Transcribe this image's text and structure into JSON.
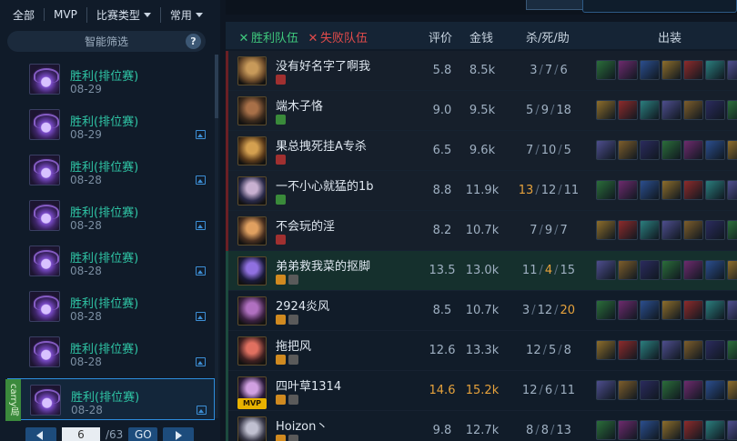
{
  "filter_tabs": [
    {
      "label": "全部"
    },
    {
      "label": "MVP"
    },
    {
      "label": "比赛类型"
    },
    {
      "label": "常用"
    }
  ],
  "smart_filter": {
    "label": "智能筛选",
    "help": "?"
  },
  "matches": [
    {
      "result": "胜利(排位赛)",
      "date": "08-29"
    },
    {
      "result": "胜利(排位赛)",
      "date": "08-29"
    },
    {
      "result": "胜利(排位赛)",
      "date": "08-28"
    },
    {
      "result": "胜利(排位赛)",
      "date": "08-28"
    },
    {
      "result": "胜利(排位赛)",
      "date": "08-28"
    },
    {
      "result": "胜利(排位赛)",
      "date": "08-28"
    },
    {
      "result": "胜利(排位赛)",
      "date": "08-28"
    },
    {
      "result": "胜利(排位赛)",
      "date": "08-28",
      "carry_tag": "carry局"
    }
  ],
  "pager": {
    "page": "6",
    "total": "/63",
    "go": "GO"
  },
  "board": {
    "win_team": "胜利队伍",
    "lose_team": "失败队伍",
    "columns": {
      "rating": "评价",
      "gold": "金钱",
      "kda": "杀/死/助",
      "items": "出装"
    }
  },
  "players": [
    {
      "name": "没有好名字了啊我",
      "rating": "5.8",
      "gold": "8.5k",
      "k": "3",
      "d": "7",
      "a": "6",
      "team": "lose"
    },
    {
      "name": "端木子恪",
      "rating": "9.0",
      "gold": "9.5k",
      "k": "5",
      "d": "9",
      "a": "18",
      "team": "lose"
    },
    {
      "name": "果总拽死挂A专杀",
      "rating": "6.5",
      "gold": "9.6k",
      "k": "7",
      "d": "10",
      "a": "5",
      "team": "lose"
    },
    {
      "name": "一不小心就猛的1b",
      "rating": "8.8",
      "gold": "11.9k",
      "k": "13",
      "d": "12",
      "a": "11",
      "team": "lose",
      "hi_k": true
    },
    {
      "name": "不会玩的淫",
      "rating": "8.2",
      "gold": "10.7k",
      "k": "7",
      "d": "9",
      "a": "7",
      "team": "lose"
    },
    {
      "name": "弟弟救我菜的抠脚",
      "rating": "13.5",
      "gold": "13.0k",
      "k": "11",
      "d": "4",
      "a": "15",
      "team": "win",
      "hi_d": true
    },
    {
      "name": "2924炎风",
      "rating": "8.5",
      "gold": "10.7k",
      "k": "3",
      "d": "12",
      "a": "20",
      "team": "win",
      "hi_a": true
    },
    {
      "name": "拖把风",
      "rating": "12.6",
      "gold": "13.3k",
      "k": "12",
      "d": "5",
      "a": "8",
      "team": "win"
    },
    {
      "name": "四叶草1314",
      "rating": "14.6",
      "gold": "15.2k",
      "k": "12",
      "d": "6",
      "a": "11",
      "team": "win",
      "mvp": "MVP",
      "hi_rating": true
    },
    {
      "name": "Hoizon丶",
      "rating": "9.8",
      "gold": "12.7k",
      "k": "8",
      "d": "8",
      "a": "13",
      "team": "win"
    }
  ],
  "colors": {
    "win": "#3fc97d",
    "lose": "#e14b4b",
    "accent": "#2d8ddd",
    "highlight": "#e6a23c"
  }
}
